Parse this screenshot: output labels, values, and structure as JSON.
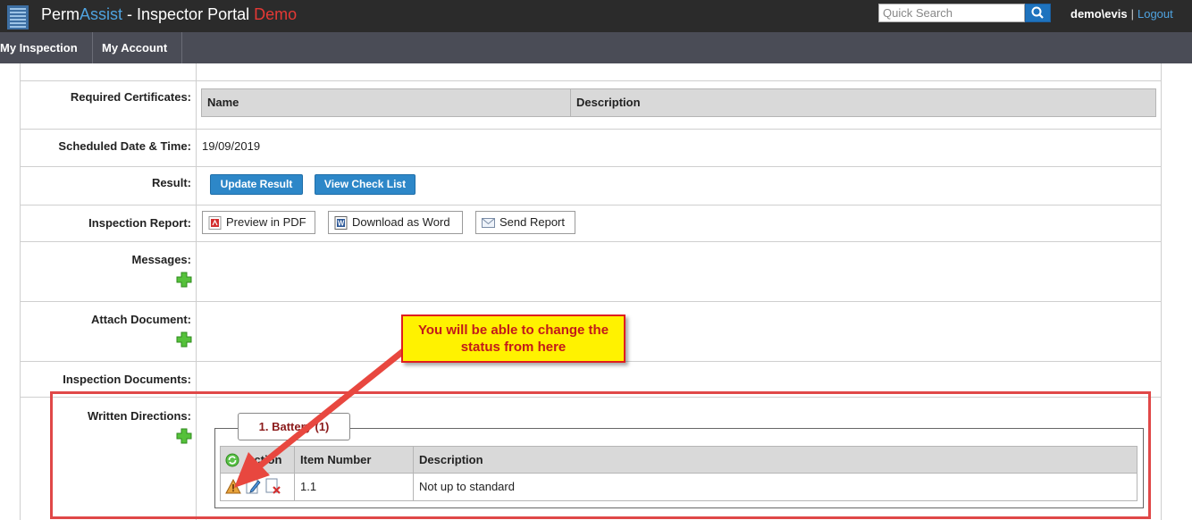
{
  "header": {
    "brand_part1": "Perm",
    "brand_part2": "Assist",
    "brand_part3": " - Inspector Portal ",
    "brand_part4": "Demo",
    "search_placeholder": "Quick Search",
    "user": "demo\\evis",
    "separator": "|",
    "logout": "Logout",
    "logo_icon": "building-logo-icon",
    "search_icon": "magnifier-icon"
  },
  "nav": {
    "items": [
      {
        "label": "My Inspection"
      },
      {
        "label": "My Account"
      }
    ]
  },
  "form": {
    "required_certificates": {
      "label": "Required Certificates:",
      "columns": [
        "Name",
        "Description"
      ]
    },
    "scheduled": {
      "label": "Scheduled Date & Time:",
      "value": "19/09/2019"
    },
    "result": {
      "label": "Result:",
      "update_button": "Update Result",
      "checklist_button": "View Check List"
    },
    "inspection_report": {
      "label": "Inspection Report:",
      "pdf": "Preview in PDF",
      "word": "Download as Word",
      "send": "Send Report"
    },
    "messages": {
      "label": "Messages:"
    },
    "attach_document": {
      "label": "Attach Document:"
    },
    "inspection_documents": {
      "label": "Inspection Documents:"
    },
    "written_directions": {
      "label": "Written Directions:",
      "legend": "1. Battery (1)",
      "columns": [
        "Action",
        "Item Number",
        "Description"
      ],
      "rows": [
        {
          "item_number": "1.1",
          "description": "Not up to standard"
        }
      ]
    }
  },
  "callout": {
    "text": "You will be able to change the status from here"
  },
  "colors": {
    "topbar": "#2b2b2b",
    "navbar": "#4a4c56",
    "accent_blue": "#2d87c8",
    "brand_blue": "#4fa3e0",
    "demo_red": "#e53935",
    "callout_yellow": "#fff200",
    "annotation_red": "#e04848"
  }
}
